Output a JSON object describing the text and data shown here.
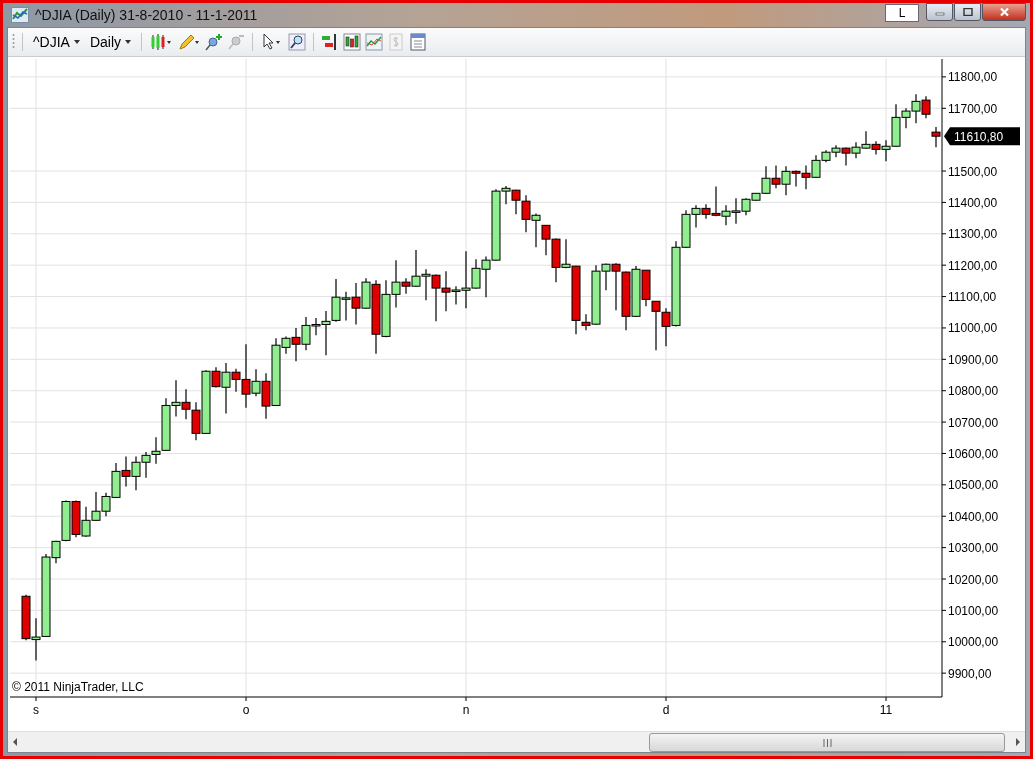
{
  "window": {
    "title": "^DJIA (Daily)  31-8-2010 - 11-1-2011",
    "layout_button": "L"
  },
  "toolbar": {
    "instrument": "^DJIA",
    "interval": "Daily"
  },
  "chart": {
    "copyright": "© 2011 NinjaTrader, LLC",
    "last_price": "11610,80",
    "chart_data": {
      "type": "candlestick",
      "grid": true,
      "ylim": [
        9824,
        11857
      ],
      "categories": [
        null,
        "s",
        null,
        null,
        null,
        null,
        null,
        null,
        null,
        null,
        null,
        null,
        null,
        null,
        null,
        null,
        null,
        null,
        null,
        null,
        null,
        null,
        "o",
        null,
        null,
        null,
        null,
        null,
        null,
        null,
        null,
        null,
        null,
        null,
        null,
        null,
        null,
        null,
        null,
        null,
        null,
        null,
        null,
        null,
        "n",
        null,
        null,
        null,
        null,
        null,
        null,
        null,
        null,
        null,
        null,
        null,
        null,
        null,
        null,
        null,
        null,
        null,
        null,
        null,
        "d",
        null,
        null,
        null,
        null,
        null,
        null,
        null,
        null,
        null,
        null,
        null,
        null,
        null,
        null,
        null,
        null,
        null,
        null,
        null,
        null,
        null,
        "11",
        null,
        null,
        null,
        null,
        null
      ],
      "yticks": [
        {
          "value": 9900,
          "label": "9900,00"
        },
        {
          "value": 10000,
          "label": "10000,00"
        },
        {
          "value": 10100,
          "label": "10100,00"
        },
        {
          "value": 10200,
          "label": "10200,00"
        },
        {
          "value": 10300,
          "label": "10300,00"
        },
        {
          "value": 10400,
          "label": "10400,00"
        },
        {
          "value": 10500,
          "label": "10500,00"
        },
        {
          "value": 10600,
          "label": "10600,00"
        },
        {
          "value": 10700,
          "label": "10700,00"
        },
        {
          "value": 10800,
          "label": "10800,00"
        },
        {
          "value": 10900,
          "label": "10900,00"
        },
        {
          "value": 11000,
          "label": "11000,00"
        },
        {
          "value": 11100,
          "label": "11100,00"
        },
        {
          "value": 11200,
          "label": "11200,00"
        },
        {
          "value": 11300,
          "label": "11300,00"
        },
        {
          "value": 11400,
          "label": "11400,00"
        },
        {
          "value": 11500,
          "label": "11500,00"
        },
        {
          "value": 11700,
          "label": "11700,00"
        },
        {
          "value": 11800,
          "label": "11800,00"
        }
      ],
      "ohlc": [
        [
          10145,
          10150,
          10005,
          10010
        ],
        [
          10007,
          10075,
          9940,
          10015
        ],
        [
          10017,
          10280,
          10015,
          10270
        ],
        [
          10268,
          10322,
          10250,
          10320
        ],
        [
          10323,
          10450,
          10320,
          10447
        ],
        [
          10447,
          10450,
          10333,
          10342
        ],
        [
          10337,
          10430,
          10335,
          10387
        ],
        [
          10387,
          10477,
          10385,
          10416
        ],
        [
          10416,
          10475,
          10400,
          10463
        ],
        [
          10460,
          10570,
          10458,
          10543
        ],
        [
          10546,
          10590,
          10495,
          10527
        ],
        [
          10527,
          10590,
          10483,
          10572
        ],
        [
          10572,
          10605,
          10523,
          10594
        ],
        [
          10597,
          10652,
          10567,
          10607
        ],
        [
          10610,
          10776,
          10608,
          10753
        ],
        [
          10753,
          10833,
          10718,
          10763
        ],
        [
          10763,
          10805,
          10709,
          10741
        ],
        [
          10738,
          10763,
          10642,
          10664
        ],
        [
          10664,
          10865,
          10662,
          10862
        ],
        [
          10862,
          10875,
          10810,
          10813
        ],
        [
          10811,
          10888,
          10727,
          10859
        ],
        [
          10859,
          10870,
          10797,
          10836
        ],
        [
          10836,
          10948,
          10746,
          10789
        ],
        [
          10792,
          10868,
          10782,
          10830
        ],
        [
          10830,
          10856,
          10711,
          10751
        ],
        [
          10753,
          10967,
          10751,
          10945
        ],
        [
          10938,
          10973,
          10918,
          10967
        ],
        [
          10970,
          11000,
          10894,
          10948
        ],
        [
          10948,
          11035,
          10929,
          11008
        ],
        [
          11008,
          11032,
          10977,
          11011
        ],
        [
          11011,
          11054,
          10913,
          11021
        ],
        [
          11024,
          11156,
          11020,
          11098
        ],
        [
          11094,
          11115,
          11024,
          11096
        ],
        [
          11098,
          11143,
          11011,
          11063
        ],
        [
          11063,
          11158,
          11060,
          11146
        ],
        [
          11139,
          11152,
          10918,
          10980
        ],
        [
          10973,
          11152,
          10970,
          11107
        ],
        [
          11107,
          11216,
          11065,
          11146
        ],
        [
          11146,
          11158,
          11109,
          11133
        ],
        [
          11133,
          11248,
          11131,
          11165
        ],
        [
          11165,
          11187,
          11088,
          11171
        ],
        [
          11168,
          11170,
          11021,
          11127
        ],
        [
          11127,
          11181,
          11053,
          11114
        ],
        [
          11119,
          11133,
          11075,
          11121
        ],
        [
          11120,
          11244,
          11063,
          11127
        ],
        [
          11127,
          11219,
          11125,
          11190
        ],
        [
          11187,
          11228,
          11098,
          11216
        ],
        [
          11216,
          11442,
          11214,
          11436
        ],
        [
          11436,
          11452,
          11394,
          11445
        ],
        [
          11439,
          11440,
          11362,
          11407
        ],
        [
          11404,
          11423,
          11305,
          11346
        ],
        [
          11343,
          11365,
          11257,
          11359
        ],
        [
          11327,
          11328,
          11232,
          11283
        ],
        [
          11283,
          11285,
          11146,
          11193
        ],
        [
          11193,
          11283,
          11190,
          11203
        ],
        [
          11197,
          11198,
          10980,
          11024
        ],
        [
          11018,
          11044,
          10993,
          11008
        ],
        [
          11012,
          11200,
          11010,
          11181
        ],
        [
          11181,
          11205,
          11120,
          11203
        ],
        [
          11203,
          11206,
          11056,
          11181
        ],
        [
          11178,
          11180,
          10993,
          11037
        ],
        [
          11037,
          11197,
          11035,
          11187
        ],
        [
          11184,
          11185,
          11069,
          11091
        ],
        [
          11085,
          11086,
          10929,
          11053
        ],
        [
          11050,
          11063,
          10942,
          11005
        ],
        [
          11008,
          11276,
          11005,
          11257
        ],
        [
          11257,
          11375,
          11255,
          11362
        ],
        [
          11362,
          11391,
          11320,
          11381
        ],
        [
          11381,
          11394,
          11348,
          11362
        ],
        [
          11365,
          11451,
          11356,
          11359
        ],
        [
          11356,
          11391,
          11327,
          11372
        ],
        [
          11371,
          11413,
          11332,
          11373
        ],
        [
          11372,
          11413,
          11359,
          11410
        ],
        [
          11407,
          11430,
          11405,
          11429
        ],
        [
          11429,
          11515,
          11427,
          11477
        ],
        [
          11477,
          11518,
          11445,
          11458
        ],
        [
          11458,
          11515,
          11423,
          11499
        ],
        [
          11499,
          11502,
          11451,
          11493
        ],
        [
          11493,
          11518,
          11442,
          11480
        ],
        [
          11480,
          11550,
          11478,
          11534
        ],
        [
          11534,
          11566,
          11528,
          11560
        ],
        [
          11560,
          11582,
          11544,
          11573
        ],
        [
          11573,
          11575,
          11518,
          11557
        ],
        [
          11557,
          11592,
          11541,
          11576
        ],
        [
          11573,
          11627,
          11571,
          11585
        ],
        [
          11585,
          11595,
          11553,
          11569
        ],
        [
          11569,
          11598,
          11531,
          11579
        ],
        [
          11579,
          11713,
          11577,
          11671
        ],
        [
          11671,
          11700,
          11636,
          11691
        ],
        [
          11691,
          11745,
          11652,
          11722
        ],
        [
          11726,
          11738,
          11668,
          11681
        ],
        [
          11624,
          11640,
          11576,
          11611
        ]
      ]
    }
  }
}
